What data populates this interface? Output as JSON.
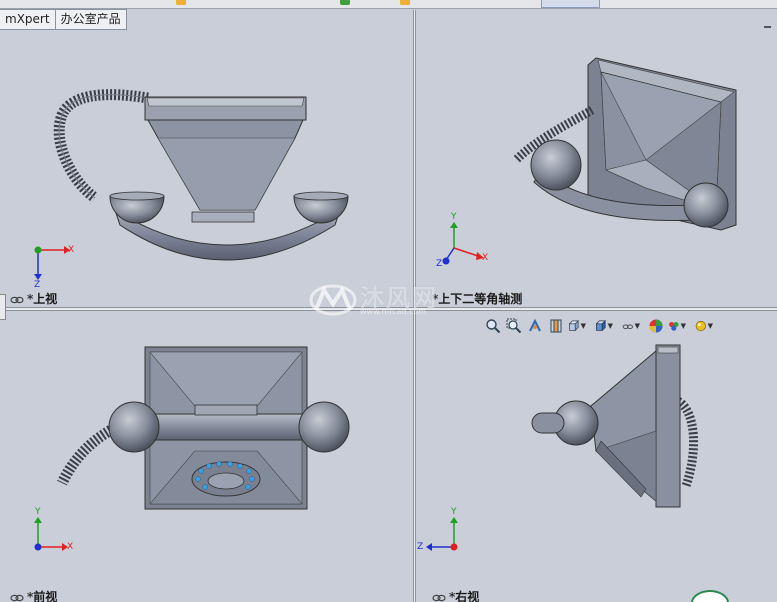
{
  "window": {
    "tabs": [
      {
        "label": "mXpert"
      },
      {
        "label": "办公室产品"
      }
    ]
  },
  "viewports": {
    "top": {
      "label": "*上视"
    },
    "dimetric": {
      "label": "*上下二等角轴测"
    },
    "front": {
      "label": "*前视"
    },
    "right": {
      "label": "*右视"
    }
  },
  "triad_labels": {
    "x": "X",
    "y": "Y",
    "z": "Z"
  },
  "toolbar": {
    "icons": [
      "zoom-to-fit-icon",
      "zoom-area-icon",
      "previous-view-icon",
      "section-view-icon",
      "view-orientation-icon",
      "display-style-icon",
      "hide-show-items-icon",
      "edit-appearance-icon",
      "apply-scene-icon",
      "view-settings-icon"
    ]
  },
  "watermark": {
    "text": "沐风网",
    "url": "www.mfcad.com"
  },
  "colors": {
    "background": "#c9ced8",
    "model_body": "#8c93a3",
    "axis_x": "#e02020",
    "axis_y": "#20a020",
    "axis_z": "#2030d0"
  }
}
